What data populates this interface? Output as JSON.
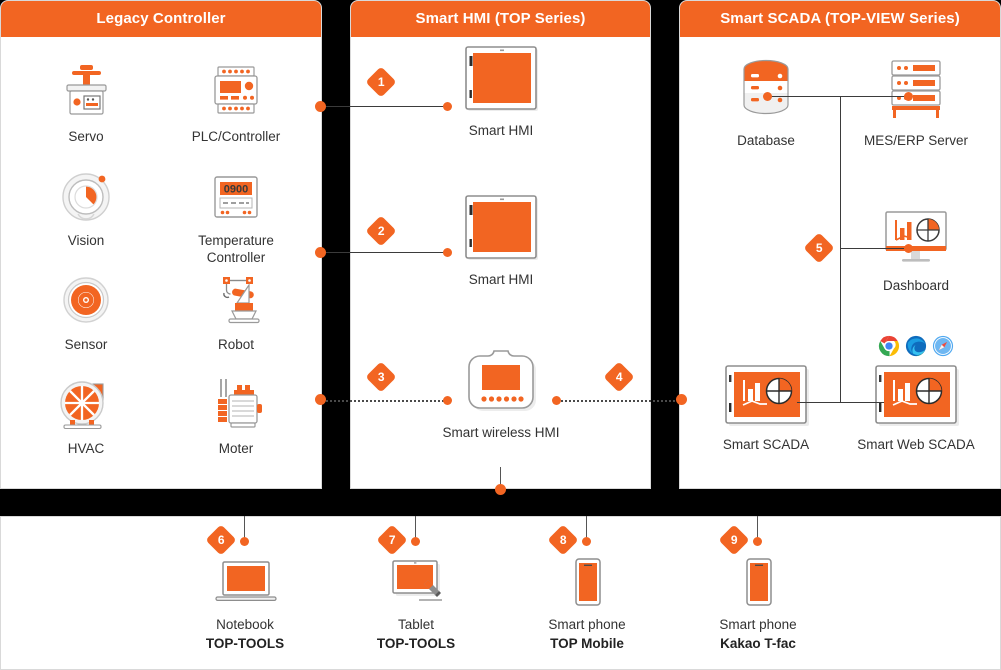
{
  "panels": {
    "legacy": {
      "title": "Legacy Controller"
    },
    "hmi": {
      "title": "Smart HMI (TOP Series)"
    },
    "scada": {
      "title": "Smart SCADA (TOP-VIEW Series)"
    }
  },
  "legacy_devices": [
    {
      "id": "servo",
      "label": "Servo",
      "icon": "servo-icon"
    },
    {
      "id": "plc",
      "label": "PLC/Controller",
      "icon": "plc-controller-icon"
    },
    {
      "id": "vision",
      "label": "Vision",
      "icon": "vision-camera-icon"
    },
    {
      "id": "temperature",
      "label": "Temperature\nController",
      "label_line1": "Temperature",
      "label_line2": "Controller",
      "icon": "temperature-controller-icon",
      "display_value": "0900"
    },
    {
      "id": "sensor",
      "label": "Sensor",
      "icon": "sensor-icon"
    },
    {
      "id": "robot",
      "label": "Robot",
      "icon": "robot-arm-icon"
    },
    {
      "id": "hvac",
      "label": "HVAC",
      "icon": "hvac-blower-icon"
    },
    {
      "id": "moter",
      "label": "Moter",
      "icon": "motor-icon"
    }
  ],
  "hmi_devices": [
    {
      "id": "smart-hmi-1",
      "label": "Smart HMI",
      "icon": "smart-hmi-icon"
    },
    {
      "id": "smart-hmi-2",
      "label": "Smart HMI",
      "icon": "smart-hmi-icon"
    },
    {
      "id": "smart-wireless-hmi",
      "label": "Smart wireless HMI",
      "icon": "smart-wireless-hmi-icon"
    }
  ],
  "scada_devices": [
    {
      "id": "database",
      "label": "Database",
      "icon": "database-icon"
    },
    {
      "id": "mes-erp-server",
      "label": "MES/ERP Server",
      "icon": "server-rack-icon"
    },
    {
      "id": "dashboard",
      "label": "Dashboard",
      "icon": "dashboard-monitor-icon"
    },
    {
      "id": "smart-scada",
      "label": "Smart SCADA",
      "icon": "smart-scada-icon"
    },
    {
      "id": "smart-web-scada",
      "label": "Smart Web SCADA",
      "icon": "smart-web-scada-icon"
    }
  ],
  "browsers": [
    {
      "id": "chrome",
      "name": "chrome-browser-icon"
    },
    {
      "id": "edge",
      "name": "edge-browser-icon"
    },
    {
      "id": "safari",
      "name": "safari-browser-icon"
    }
  ],
  "bottom_devices": [
    {
      "id": "notebook",
      "label": "Notebook",
      "sublabel": "TOP-TOOLS",
      "marker": "6",
      "icon": "notebook-laptop-icon"
    },
    {
      "id": "tablet",
      "label": "Tablet",
      "sublabel": "TOP-TOOLS",
      "marker": "7",
      "icon": "tablet-stylus-icon"
    },
    {
      "id": "smart-phone-1",
      "label": "Smart phone",
      "sublabel": "TOP Mobile",
      "marker": "8",
      "icon": "smartphone-icon"
    },
    {
      "id": "smart-phone-2",
      "label": "Smart phone",
      "sublabel": "Kakao T-fac",
      "marker": "9",
      "icon": "smartphone-icon"
    }
  ],
  "markers": {
    "m1": "1",
    "m2": "2",
    "m3": "3",
    "m4": "4",
    "m5": "5"
  },
  "colors": {
    "accent": "#F26522",
    "header_bg": "#F26522",
    "line": "#3b3b3b",
    "panel_bg": "#FFFFFF",
    "gap": "#000000",
    "text": "#333333"
  }
}
